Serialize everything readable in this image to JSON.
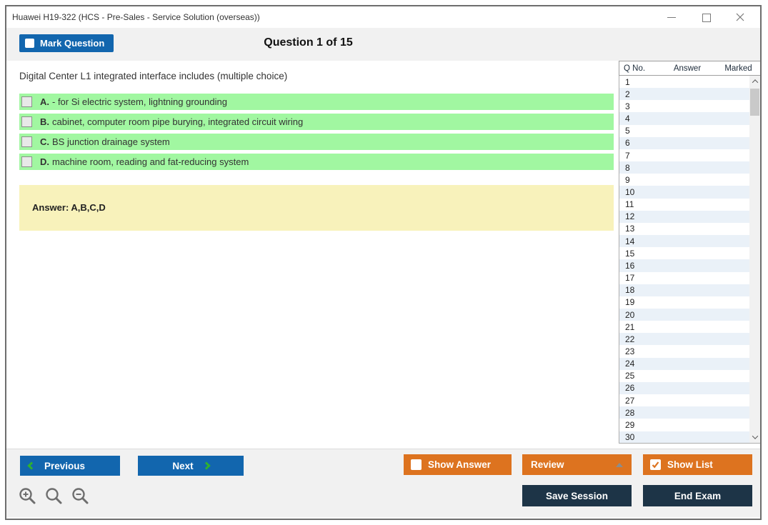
{
  "window": {
    "title": "Huawei H19-322 (HCS - Pre-Sales - Service Solution (overseas))",
    "controls": [
      "minimize",
      "maximize",
      "close"
    ]
  },
  "header": {
    "mark_question_label": "Mark Question",
    "question_counter": "Question 1 of 15"
  },
  "question": {
    "text": "Digital Center L1 integrated interface includes (multiple choice)",
    "options": [
      {
        "letter": "A.",
        "text": "- for Si electric system, lightning grounding"
      },
      {
        "letter": "B.",
        "text": "cabinet, computer room pipe burying, integrated circuit wiring"
      },
      {
        "letter": "C.",
        "text": "BS junction drainage system"
      },
      {
        "letter": "D.",
        "text": "machine room, reading and fat-reducing system"
      }
    ],
    "answer_text": "Answer: A,B,C,D"
  },
  "sidebar": {
    "columns": {
      "qno": "Q No.",
      "answer": "Answer",
      "marked": "Marked"
    },
    "rows": [
      1,
      2,
      3,
      4,
      5,
      6,
      7,
      8,
      9,
      10,
      11,
      12,
      13,
      14,
      15,
      16,
      17,
      18,
      19,
      20,
      21,
      22,
      23,
      24,
      25,
      26,
      27,
      28,
      29,
      30
    ]
  },
  "footer": {
    "previous_label": "Previous",
    "next_label": "Next",
    "show_answer_label": "Show Answer",
    "review_label": "Review",
    "show_list_label": "Show List",
    "save_session_label": "Save Session",
    "end_exam_label": "End Exam",
    "show_answer_checked": false,
    "show_list_checked": true
  },
  "colors": {
    "accent_blue": "#1266ae",
    "accent_orange": "#dd731f",
    "navy": "#1d3447",
    "option_green": "#a1f7a1",
    "answer_yellow": "#f8f2bb",
    "row_alt_blue": "#eaf1f8",
    "chevron_green": "#2fb12f"
  }
}
